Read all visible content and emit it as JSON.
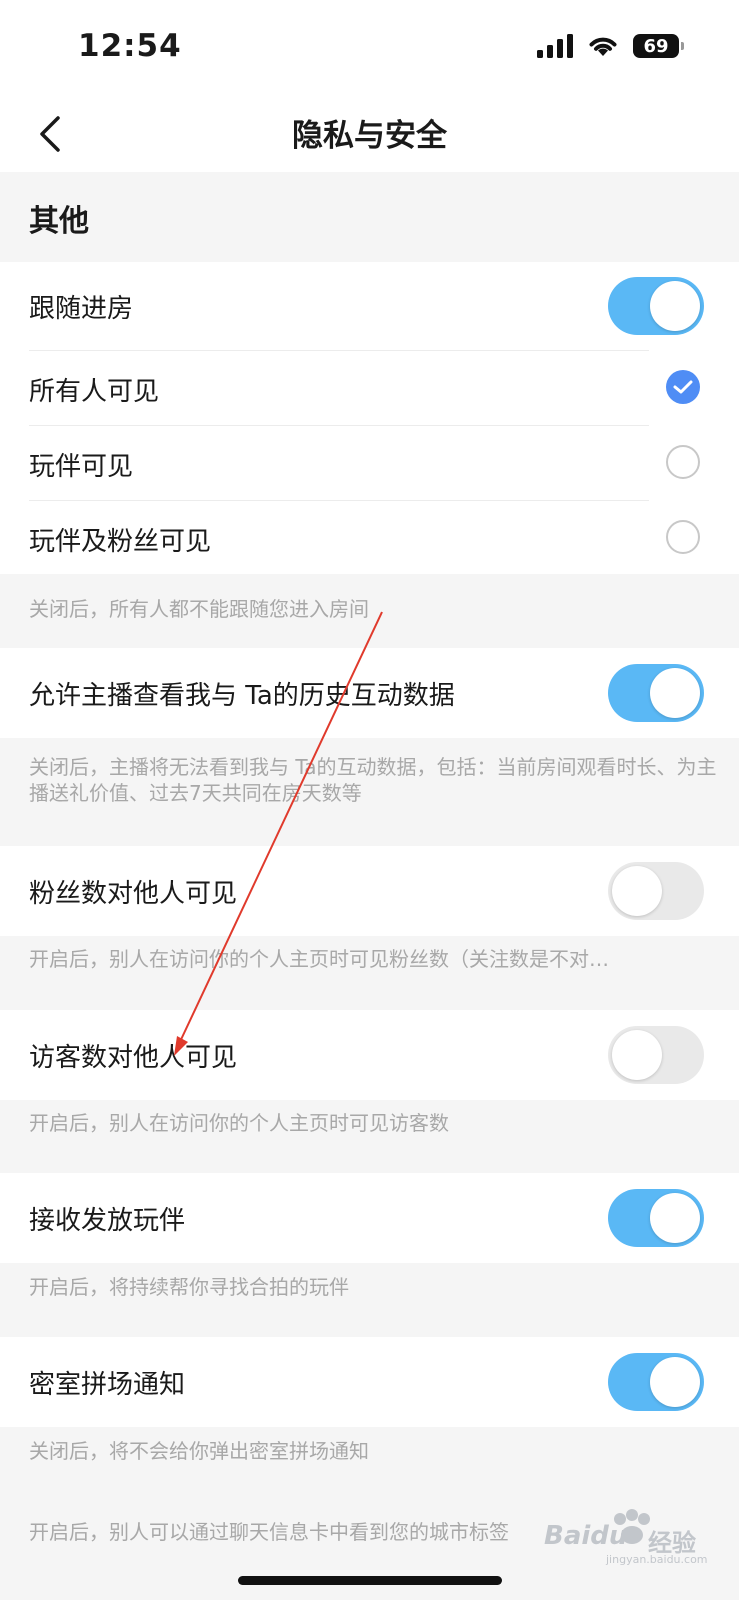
{
  "status_bar": {
    "time": "12:54",
    "battery": "69",
    "icons": [
      "signal-icon",
      "wifi-icon",
      "battery-icon"
    ]
  },
  "nav": {
    "title": "隐私与安全",
    "back_icon": "chevron-left-icon"
  },
  "section": {
    "title": "其他"
  },
  "follow_room": {
    "label": "跟随进房",
    "enabled": true,
    "options": [
      {
        "label": "所有人可见",
        "selected": true
      },
      {
        "label": "玩伴可见",
        "selected": false
      },
      {
        "label": "玩伴及粉丝可见",
        "selected": false
      }
    ],
    "hint": "关闭后，所有人都不能跟随您进入房间"
  },
  "history_data": {
    "label": "允许主播查看我与 Ta的历史互动数据",
    "enabled": true,
    "hint": "关闭后，主播将无法看到我与 Ta的互动数据，包括：当前房间观看时长、为主播送礼价值、过去7天共同在房天数等"
  },
  "fans_visible": {
    "label": "粉丝数对他人可见",
    "enabled": false,
    "hint": "开启后，别人在访问你的个人主页时可见粉丝数（关注数是不对…"
  },
  "visitors_visible": {
    "label": "访客数对他人可见",
    "enabled": false,
    "hint": "开启后，别人在访问你的个人主页时可见访客数"
  },
  "receive_partner": {
    "label": "接收发放玩伴",
    "enabled": true,
    "hint": "开启后，将持续帮你寻找合拍的玩伴"
  },
  "escape_room": {
    "label": "密室拼场通知",
    "enabled": true,
    "hint": "关闭后，将不会给你弹出密室拼场通知"
  },
  "city_tag_hint": "开启后，别人可以通过聊天信息卡中看到您的城市标签",
  "watermark": {
    "brand": "Baidu",
    "cn": "经验",
    "url": "jingyan.baidu.com"
  },
  "colors": {
    "accent": "#5ab8f5",
    "check": "#4f8df5",
    "annotation": "#e03a2c"
  }
}
